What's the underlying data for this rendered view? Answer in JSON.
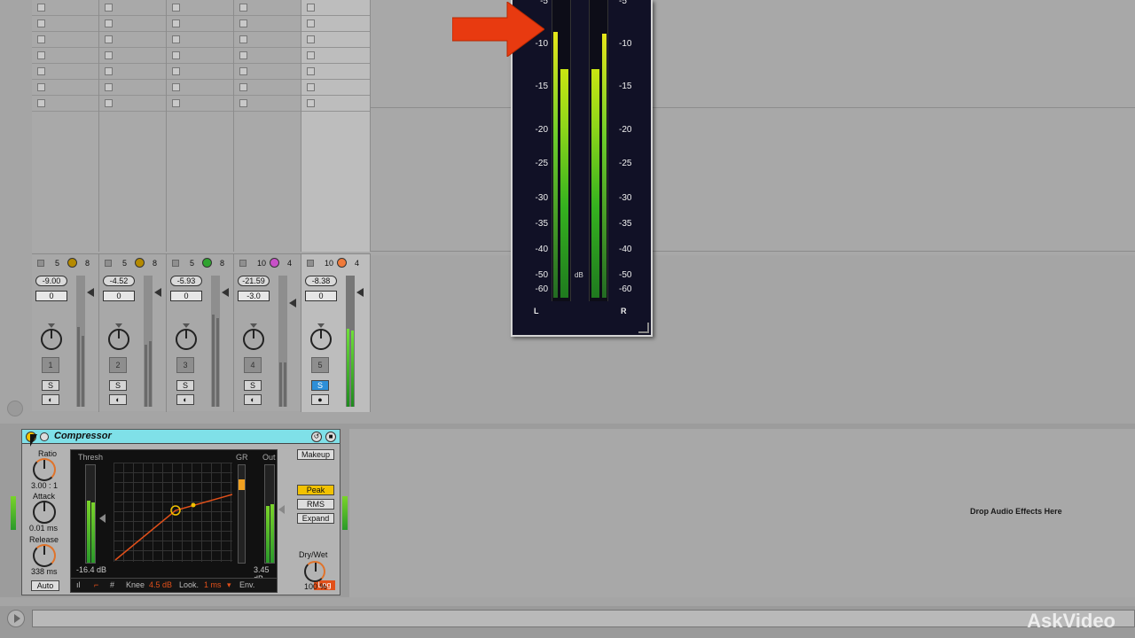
{
  "mixer": {
    "tracks": [
      {
        "in": "5",
        "out": "8",
        "volume": "-9.00",
        "pan": "0",
        "number": "1",
        "solo": "S",
        "color": "#b58a00"
      },
      {
        "in": "5",
        "out": "8",
        "volume": "-4.52",
        "pan": "0",
        "number": "2",
        "solo": "S",
        "color": "#b58a00"
      },
      {
        "in": "5",
        "out": "8",
        "volume": "-5.93",
        "pan": "0",
        "number": "3",
        "solo": "S",
        "color": "#2fa32f"
      },
      {
        "in": "10",
        "out": "4",
        "volume": "-21.59",
        "pan": "-3.0",
        "number": "4",
        "solo": "S",
        "color": "#c850c8"
      },
      {
        "in": "10",
        "out": "4",
        "volume": "-8.38",
        "pan": "0",
        "number": "5",
        "solo": "S",
        "color": "#f07a3a"
      }
    ]
  },
  "meter": {
    "scale": [
      "-5",
      "-10",
      "-15",
      "-20",
      "-25",
      "-30",
      "-35",
      "-40",
      "-50",
      "-60"
    ],
    "db_label": "dB",
    "left_label": "L",
    "right_label": "R",
    "colors": {
      "background": "#111126",
      "low": "#1f7a1f",
      "high": "#c9e612"
    }
  },
  "arrow": {
    "color": "#e83a10"
  },
  "compressor": {
    "title": "Compressor",
    "ratio_label": "Ratio",
    "ratio_value": "3.00 : 1",
    "attack_label": "Attack",
    "attack_value": "0.01 ms",
    "release_label": "Release",
    "release_value": "338 ms",
    "auto_label": "Auto",
    "thresh_label": "Thresh",
    "gr_label": "GR",
    "out_label": "Out",
    "thresh_value": "-16.4 dB",
    "out_value": "3.45 dB",
    "knee_label": "Knee",
    "knee_value": "4.5 dB",
    "look_label": "Look.",
    "look_value": "1 ms",
    "env_label": "Env.",
    "log_label": "Log",
    "makeup_label": "Makeup",
    "peak_label": "Peak",
    "rms_label": "RMS",
    "expand_label": "Expand",
    "drywet_label": "Dry/Wet",
    "drywet_value": "100 %",
    "title_color": "#7fe0e8"
  },
  "device_chain": {
    "drop_hint": "Drop Audio Effects Here"
  },
  "watermark": "AskVideo"
}
